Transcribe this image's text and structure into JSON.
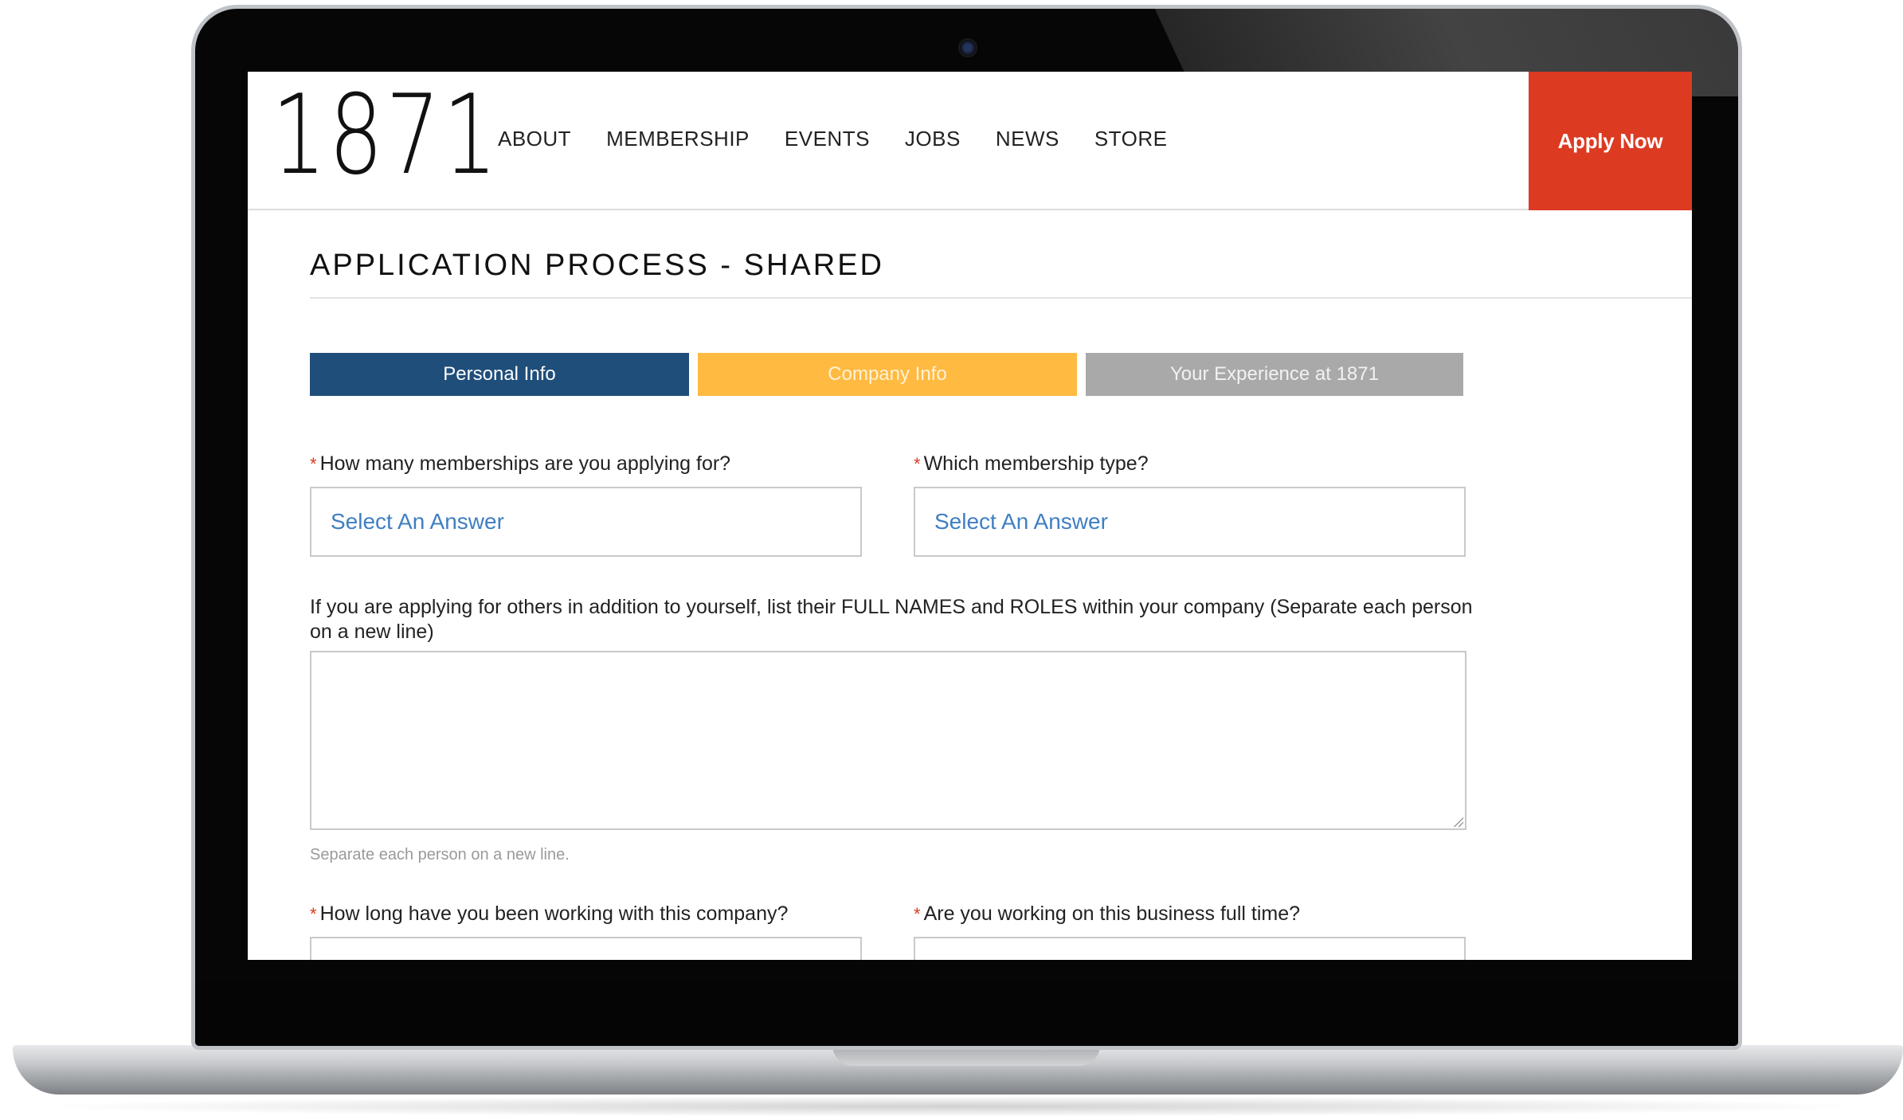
{
  "header": {
    "logo": "1871",
    "nav": [
      "ABOUT",
      "MEMBERSHIP",
      "EVENTS",
      "JOBS",
      "NEWS",
      "STORE"
    ],
    "apply_label": "Apply Now"
  },
  "page": {
    "title": "APPLICATION PROCESS - SHARED"
  },
  "steps": [
    "Personal Info",
    "Company Info",
    "Your Experience at 1871"
  ],
  "form": {
    "q1_label": "How many memberships are you applying for?",
    "q1_value": "Select An Answer",
    "q2_label": "Which membership type?",
    "q2_value": "Select An Answer",
    "others_label": "If you are applying for others in addition to yourself, list their FULL NAMES and ROLES within your company (Separate each person on a new line)",
    "others_hint": "Separate each person on a new line.",
    "q3_label": "How long have you been working with this company?",
    "q4_label": "Are you working on this business full time?",
    "required_marker": "*"
  },
  "colors": {
    "apply": "#dd3a22",
    "step_active": "#1f4e7a",
    "step_company": "#ffba42",
    "step_experience": "#a9a9a9",
    "select_text": "#3f7fc2"
  }
}
